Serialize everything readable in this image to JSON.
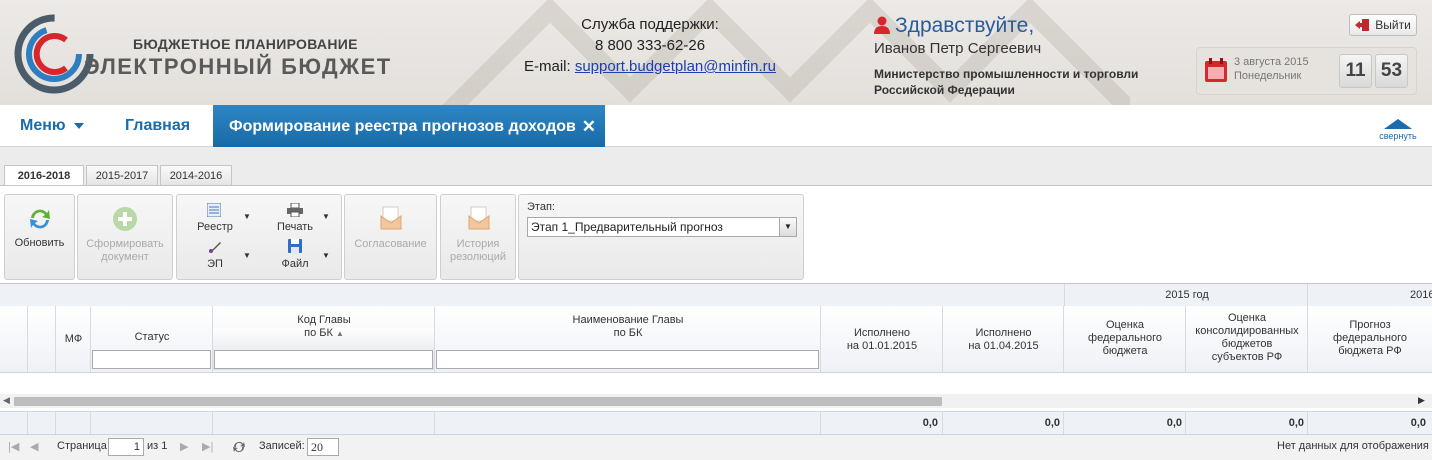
{
  "header": {
    "logo_line1": "БЮДЖЕТНОЕ ПЛАНИРОВАНИЕ",
    "logo_line2": "ЭЛЕКТРОННЫЙ БЮДЖЕТ",
    "support_title": "Служба поддержки:",
    "support_phone": "8 800 333-62-26",
    "support_email_label": "E-mail:",
    "support_email": "support.budgetplan@minfin.ru",
    "greeting": "Здравствуйте,",
    "user_name": "Иванов Петр Сергеевич",
    "org_name": "Министерство промышленности и торговли Российской Федерации",
    "logout_label": "Выйти",
    "date_line1": "3 августа 2015",
    "date_line2": "Понедельник",
    "clock_hours": "11",
    "clock_minutes": "53"
  },
  "nav": {
    "menu_label": "Меню",
    "home_label": "Главная",
    "active_tab_label": "Формирование реестра прогнозов доходов",
    "collapse_label": "свернуть"
  },
  "period_tabs": [
    "2016-2018",
    "2015-2017",
    "2014-2016"
  ],
  "toolbar": {
    "refresh_label": "Обновить",
    "form_doc_label_1": "Сформировать",
    "form_doc_label_2": "документ",
    "registry_label": "Реестр",
    "print_label": "Печать",
    "ep_label": "ЭП",
    "file_label": "Файл",
    "approval_label": "Согласование",
    "history_label_1": "История",
    "history_label_2": "резолюций",
    "stage_label": "Этап:",
    "stage_value": "Этап 1_Предварительный прогноз"
  },
  "grid": {
    "group_2015": "2015 год",
    "group_2016": "2016",
    "col_mf": "МФ",
    "col_status": "Статус",
    "col_code_1": "Код Главы",
    "col_code_2": "по БК",
    "col_name_1": "Наименование Главы",
    "col_name_2": "по БК",
    "col_exec1_1": "Исполнено",
    "col_exec1_2": "на 01.01.2015",
    "col_exec2_1": "Исполнено",
    "col_exec2_2": "на 01.04.2015",
    "col_fed_1": "Оценка",
    "col_fed_2": "федерального",
    "col_fed_3": "бюджета",
    "col_cons_1": "Оценка",
    "col_cons_2": "консолидированных",
    "col_cons_3": "бюджетов",
    "col_cons_4": "субъектов РФ",
    "col_prog_1": "Прогноз",
    "col_prog_2": "федерального",
    "col_prog_3": "бюджета РФ",
    "totals": [
      "0,0",
      "0,0",
      "0,0",
      "0,0",
      "0,0"
    ]
  },
  "pager": {
    "page_label": "Страница",
    "page_value": "1",
    "of_label": "из 1",
    "records_label": "Записей:",
    "records_value": "20",
    "no_data": "Нет данных для отображения"
  }
}
